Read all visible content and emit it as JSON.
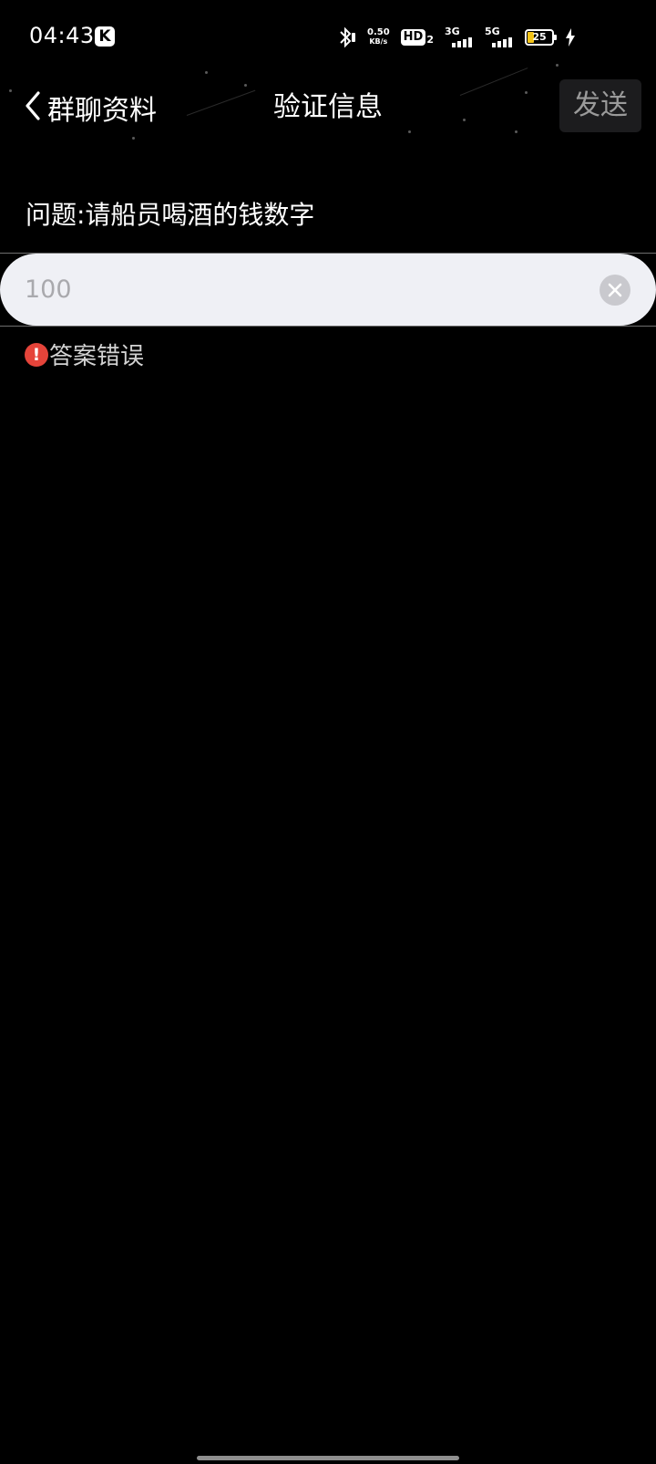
{
  "status_bar": {
    "time": "04:43",
    "app_badge": "K",
    "net_speed_value": "0.50",
    "net_speed_unit": "KB/s",
    "hd_label": "HD",
    "hd_sub": "2",
    "signal_1_label": "3G",
    "signal_2_label": "5G",
    "battery_level": "25"
  },
  "nav": {
    "back_label": "群聊资料",
    "title": "验证信息",
    "send_label": "发送"
  },
  "form": {
    "question": "问题:请船员喝酒的钱数字",
    "answer_value": "100",
    "error_icon": "!",
    "error_message": "答案错误"
  },
  "colors": {
    "background": "#000000",
    "input_background": "#eff0f5",
    "error_red": "#e5443a",
    "send_button_bg": "#1c1c1e"
  },
  "icons": {
    "back": "chevron-left-icon",
    "clear": "clear-icon",
    "error": "error-icon",
    "bluetooth": "bluetooth-icon",
    "charging": "lightning-icon"
  }
}
